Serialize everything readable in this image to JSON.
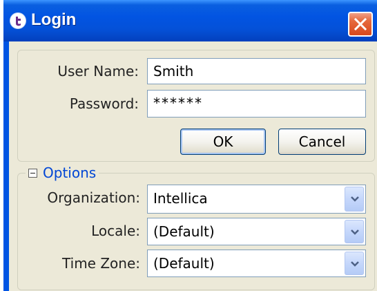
{
  "window": {
    "title": "Login",
    "icon": "app-logo-icon",
    "close_icon": "close-icon"
  },
  "credentials": {
    "username_label": "User Name:",
    "username_value": "Smith",
    "password_label": "Password:",
    "password_value": "******"
  },
  "buttons": {
    "ok_label": "OK",
    "cancel_label": "Cancel"
  },
  "options": {
    "title": "Options",
    "collapse_icon": "collapse-minus-icon",
    "organization_label": "Organization:",
    "organization_value": "Intellica",
    "locale_label": "Locale:",
    "locale_value": "(Default)",
    "timezone_label": "Time Zone:",
    "timezone_value": "(Default)",
    "dropdown_icon": "chevron-down-icon"
  },
  "colors": {
    "titlebar": "#0054e3",
    "client_background": "#ece9d8",
    "close_button": "#e0532a",
    "options_link": "#0046d5"
  }
}
